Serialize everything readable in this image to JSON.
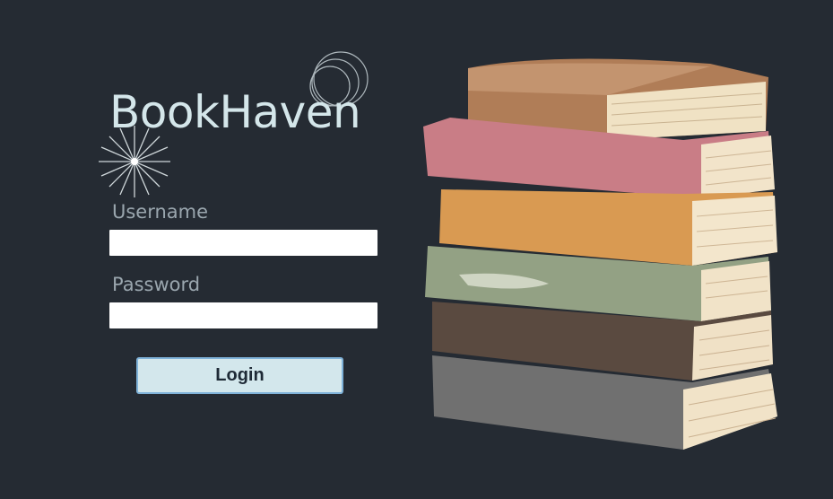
{
  "brand": {
    "name": "BookHaven",
    "color": "#d4e6ea"
  },
  "form": {
    "username_label": "Username",
    "username_value": "",
    "password_label": "Password",
    "password_value": "",
    "login_label": "Login"
  },
  "icons": [
    "concentric-rings-icon",
    "sparkle-burst-icon"
  ],
  "illustration": "watercolor-book-stack",
  "colors": {
    "background": "#252b33",
    "button": "#d3e7ec",
    "button_border": "#7fb2d9",
    "book_colors": [
      "#b07d57",
      "#c97d86",
      "#d99a52",
      "#93a184",
      "#5a4a40",
      "#707070"
    ]
  }
}
